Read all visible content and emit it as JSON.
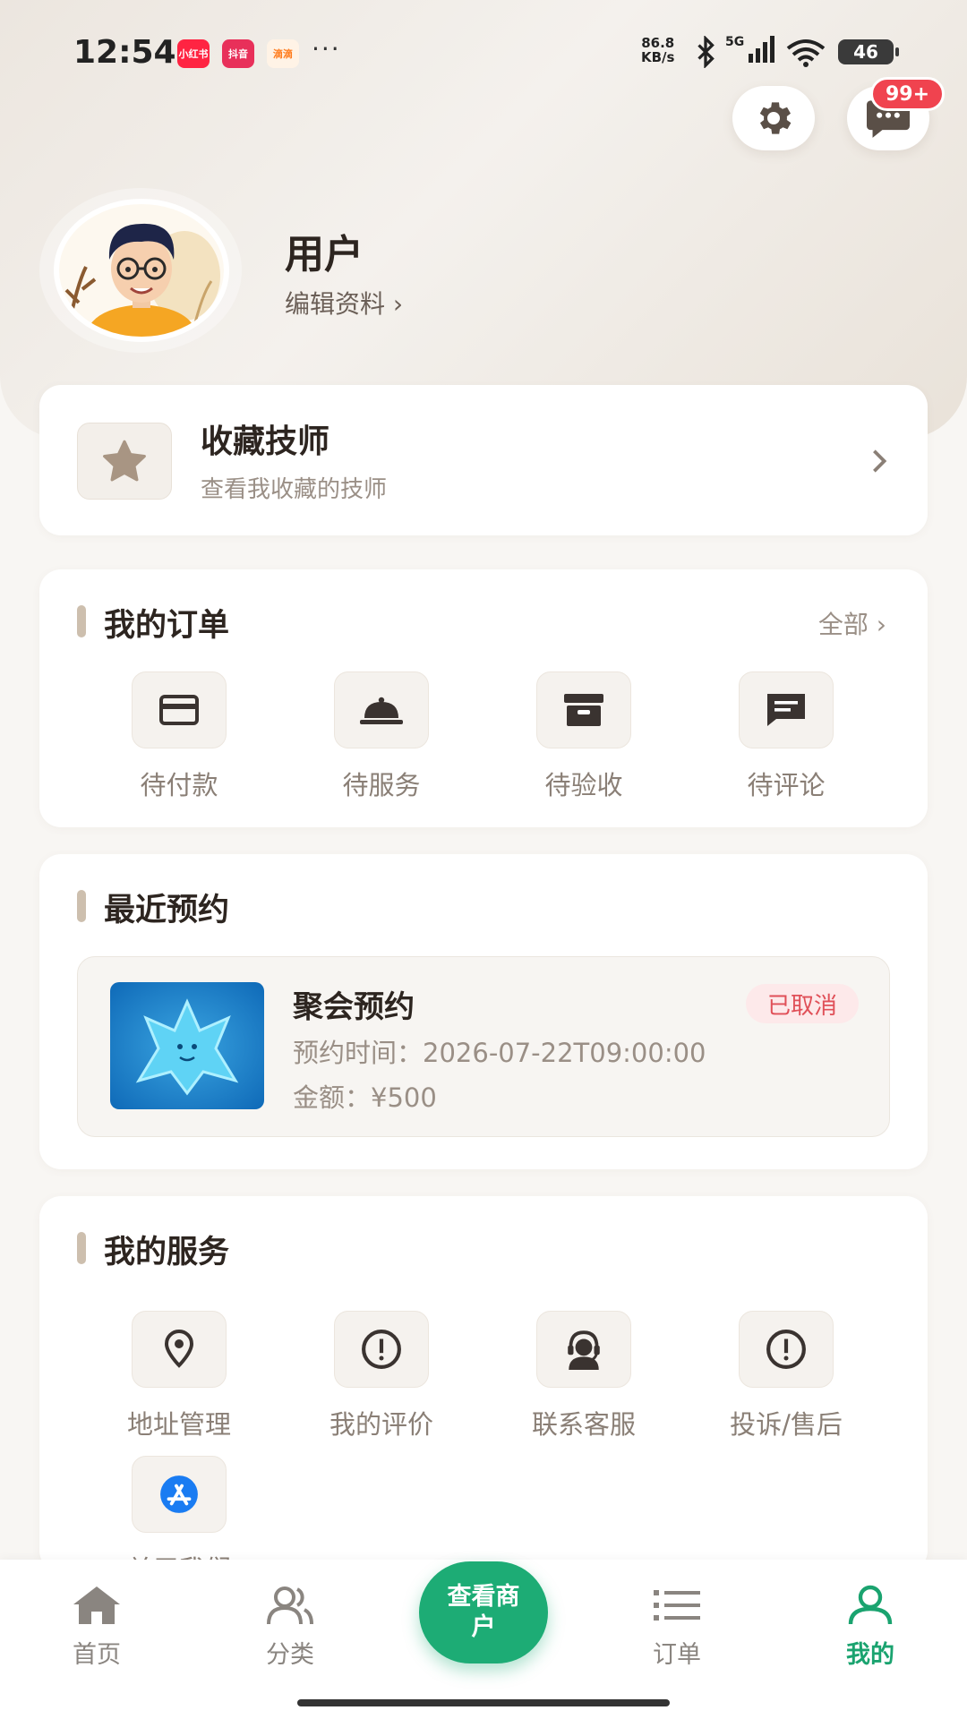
{
  "status_bar": {
    "time": "12:54",
    "apps": [
      {
        "label": "小红书",
        "color": "#ff2442"
      },
      {
        "label": "抖音",
        "color": "#e8305a"
      },
      {
        "label": "滴滴",
        "color": "#ff7a1a"
      }
    ],
    "more": "···",
    "net_speed_value": "86.8",
    "net_speed_unit": "KB/s",
    "network": "5G",
    "battery": "46"
  },
  "header": {
    "settings_icon": "gear-icon",
    "message_icon": "chat-icon",
    "message_badge": "99+"
  },
  "profile": {
    "username": "用户",
    "edit_label": "编辑资料 ›"
  },
  "favorites": {
    "title": "收藏技师",
    "subtitle": "查看我收藏的技师",
    "icon": "star-icon"
  },
  "orders": {
    "title": "我的订单",
    "view_all": "全部 ›",
    "items": [
      {
        "label": "待付款",
        "icon": "card-icon"
      },
      {
        "label": "待服务",
        "icon": "service-bell-icon"
      },
      {
        "label": "待验收",
        "icon": "archive-box-icon"
      },
      {
        "label": "待评论",
        "icon": "comment-icon"
      }
    ]
  },
  "recent": {
    "title": "最近预约",
    "appointment": {
      "title": "聚会预约",
      "status": "已取消",
      "time_label": "预约时间：",
      "time_value": "2026-07-22T09:00:00",
      "amount_label": "金额：",
      "amount_value": "¥500"
    }
  },
  "services": {
    "title": "我的服务",
    "items": [
      {
        "label": "地址管理",
        "icon": "location-pin-icon"
      },
      {
        "label": "我的评价",
        "icon": "alert-circle-icon"
      },
      {
        "label": "联系客服",
        "icon": "customer-service-icon"
      },
      {
        "label": "投诉/售后",
        "icon": "alert-circle-icon"
      },
      {
        "label": "关于我们",
        "icon": "app-store-icon"
      }
    ]
  },
  "tabbar": {
    "tabs": [
      {
        "label": "首页",
        "icon": "home-icon"
      },
      {
        "label": "分类",
        "icon": "users-icon"
      },
      {
        "label": "订单",
        "icon": "list-icon"
      },
      {
        "label": "我的",
        "icon": "user-icon"
      }
    ],
    "center_button": "查看商户",
    "active_color": "#1aa36f"
  }
}
